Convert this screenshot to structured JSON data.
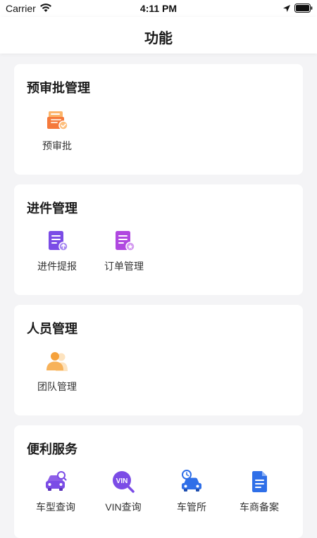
{
  "status_bar": {
    "carrier": "Carrier",
    "time": "4:11 PM"
  },
  "nav": {
    "title": "功能"
  },
  "sections": [
    {
      "title": "预审批管理",
      "items": [
        {
          "label": "预审批",
          "icon": "pre-approval-icon"
        }
      ]
    },
    {
      "title": "进件管理",
      "items": [
        {
          "label": "进件提报",
          "icon": "application-submit-icon"
        },
        {
          "label": "订单管理",
          "icon": "order-management-icon"
        }
      ]
    },
    {
      "title": "人员管理",
      "items": [
        {
          "label": "团队管理",
          "icon": "team-management-icon"
        }
      ]
    },
    {
      "title": "便利服务",
      "items": [
        {
          "label": "车型查询",
          "icon": "car-model-search-icon"
        },
        {
          "label": "VIN查询",
          "icon": "vin-search-icon"
        },
        {
          "label": "车管所",
          "icon": "vehicle-office-icon"
        },
        {
          "label": "车商备案",
          "icon": "dealer-filing-icon"
        }
      ]
    }
  ],
  "colors": {
    "background": "#f4f4f6",
    "card": "#ffffff",
    "orange": "#f5793b",
    "purple": "#7b4ce6",
    "violet": "#b048e0",
    "blue": "#2f6fe8"
  }
}
